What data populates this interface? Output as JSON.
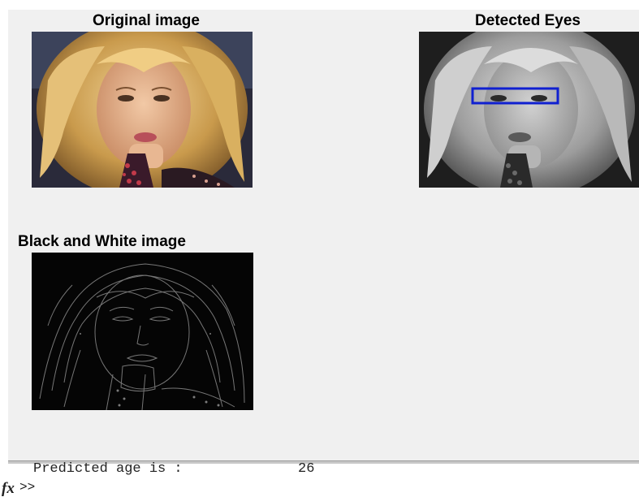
{
  "figure": {
    "panels": [
      {
        "title": "Original image",
        "image": "color-portrait"
      },
      {
        "title": "Detected Eyes",
        "image": "grayscale-portrait-with-eye-box",
        "box_color": "#1020d0"
      },
      {
        "title": "Black and White image",
        "image": "edge-map"
      }
    ]
  },
  "command_window": {
    "output_label": "Predicted age is :",
    "output_value": "26",
    "prompt": ">>",
    "fx_icon": "fx"
  }
}
